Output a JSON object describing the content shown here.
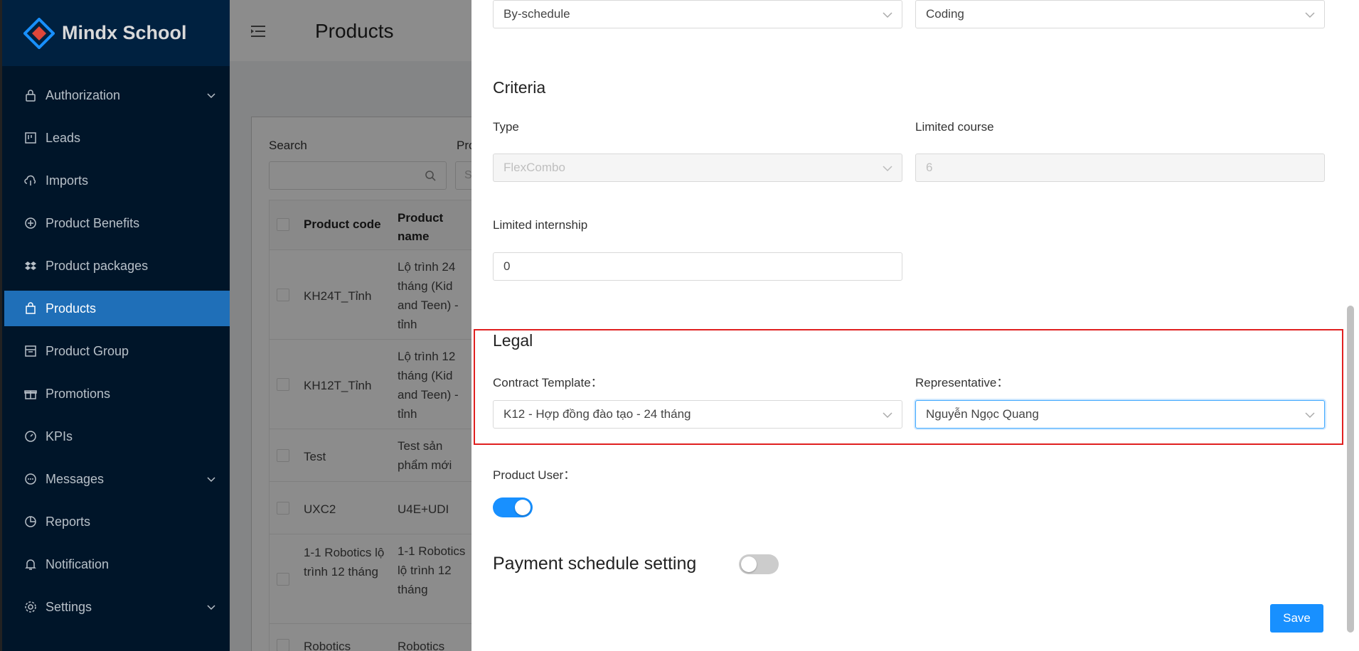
{
  "app": {
    "logo_text": "Mindx School"
  },
  "sidebar": {
    "items": [
      {
        "label": "Authorization",
        "icon": "lock-icon",
        "has_chevron": true
      },
      {
        "label": "Leads",
        "icon": "board-icon",
        "has_chevron": false
      },
      {
        "label": "Imports",
        "icon": "cloud-upload-icon",
        "has_chevron": false
      },
      {
        "label": "Product Benefits",
        "icon": "plus-circle-icon",
        "has_chevron": false
      },
      {
        "label": "Product packages",
        "icon": "dropbox-icon",
        "has_chevron": false
      },
      {
        "label": "Products",
        "icon": "shopping-icon",
        "has_chevron": false,
        "active": true
      },
      {
        "label": "Product Group",
        "icon": "group-icon",
        "has_chevron": false
      },
      {
        "label": "Promotions",
        "icon": "gift-icon",
        "has_chevron": false
      },
      {
        "label": "KPIs",
        "icon": "dashboard-icon",
        "has_chevron": false
      },
      {
        "label": "Messages",
        "icon": "message-icon",
        "has_chevron": true
      },
      {
        "label": "Reports",
        "icon": "pie-chart-icon",
        "has_chevron": false
      },
      {
        "label": "Notification",
        "icon": "bell-icon",
        "has_chevron": false
      },
      {
        "label": "Settings",
        "icon": "gear-icon",
        "has_chevron": true
      }
    ]
  },
  "main": {
    "page_title": "Products",
    "search_label": "Search",
    "second_filter_label_partial": "Pro",
    "second_filter_placeholder_partial": "S",
    "table": {
      "headers": [
        "Product code",
        "Product name"
      ],
      "rows": [
        [
          "KH24T_Tỉnh",
          "Lộ trình 24 tháng (Kid and Teen) - tỉnh"
        ],
        [
          "KH12T_Tỉnh",
          "Lộ trình 12 tháng (Kid and Teen) - tỉnh"
        ],
        [
          "Test",
          "Test sản phẩm mới"
        ],
        [
          "UXC2",
          "U4E+UDI"
        ],
        [
          "1-1 Robotics lộ trình 12 tháng",
          "1-1 Robotics lộ trình 12 tháng"
        ],
        [
          "Robotics",
          "Robotics"
        ]
      ]
    }
  },
  "drawer": {
    "top_select_left": "By-schedule",
    "top_select_right": "Coding",
    "criteria": {
      "title": "Criteria",
      "type_label": "Type",
      "type_value": "FlexCombo",
      "limited_course_label": "Limited course",
      "limited_course_value": "6",
      "limited_internship_label": "Limited internship",
      "limited_internship_value": "0"
    },
    "legal": {
      "title": "Legal",
      "contract_template_label": "Contract Template",
      "contract_template_value": "K12 - Hợp đồng đào tạo - 24 tháng",
      "representative_label": "Representative",
      "representative_value": "Nguyễn Ngọc Quang"
    },
    "product_user_label": "Product User",
    "product_user_on": true,
    "payment_schedule_label": "Payment schedule setting",
    "payment_schedule_on": false,
    "save_label": "Save"
  },
  "colors": {
    "sidebar_bg": "#001529",
    "active_item": "#1f6fb8",
    "primary": "#1890ff",
    "highlight_border": "#e02020"
  }
}
